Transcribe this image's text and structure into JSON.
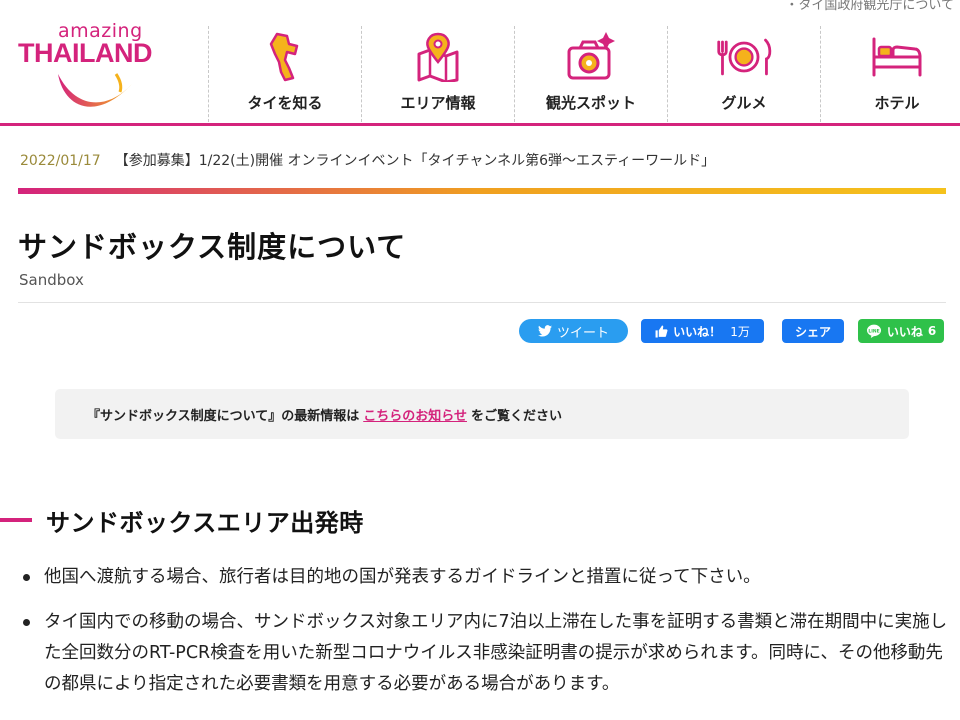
{
  "top_note": "・タイ国政府観光庁について",
  "logo": {
    "line1": "amazing",
    "line2": "THAILAND"
  },
  "nav": [
    {
      "label": "タイを知る",
      "icon": "thailand-map-icon"
    },
    {
      "label": "エリア情報",
      "icon": "map-pin-icon"
    },
    {
      "label": "観光スポット",
      "icon": "camera-icon"
    },
    {
      "label": "グルメ",
      "icon": "dish-icon"
    },
    {
      "label": "ホテル",
      "icon": "bed-icon"
    }
  ],
  "news": {
    "date": "2022/01/17",
    "text": "【参加募集】1/22(土)開催 オンラインイベント「タイチャンネル第6弾〜エスティーワールド」"
  },
  "page": {
    "title": "サンドボックス制度について",
    "subtitle": "Sandbox"
  },
  "share": {
    "tweet": "ツイート",
    "like": "いいね！",
    "like_count": "1万",
    "fb_share": "シェア",
    "line_like": "いいね",
    "line_count": "6"
  },
  "notice": {
    "before": "『サンドボックス制度について』の最新情報は",
    "link": "こちらのお知らせ",
    "after": "をご覧ください"
  },
  "section": {
    "title": "サンドボックスエリア出発時",
    "bullets": [
      "他国へ渡航する場合、旅行者は目的地の国が発表するガイドラインと措置に従って下さい。",
      "タイ国内での移動の場合、サンドボックス対象エリア内に7泊以上滞在した事を証明する書類と滞在期間中に実施した全回数分のRT-PCR検査を用いた新型コロナウイルス非感染証明書の提示が求められます。同時に、その他移動先の都県により指定された必要書類を用意する必要がある場合があります。"
    ]
  },
  "colors": {
    "accent": "#d4237c",
    "twitter": "#2a9df0",
    "facebook": "#1877f2",
    "line": "#2fc14a"
  }
}
